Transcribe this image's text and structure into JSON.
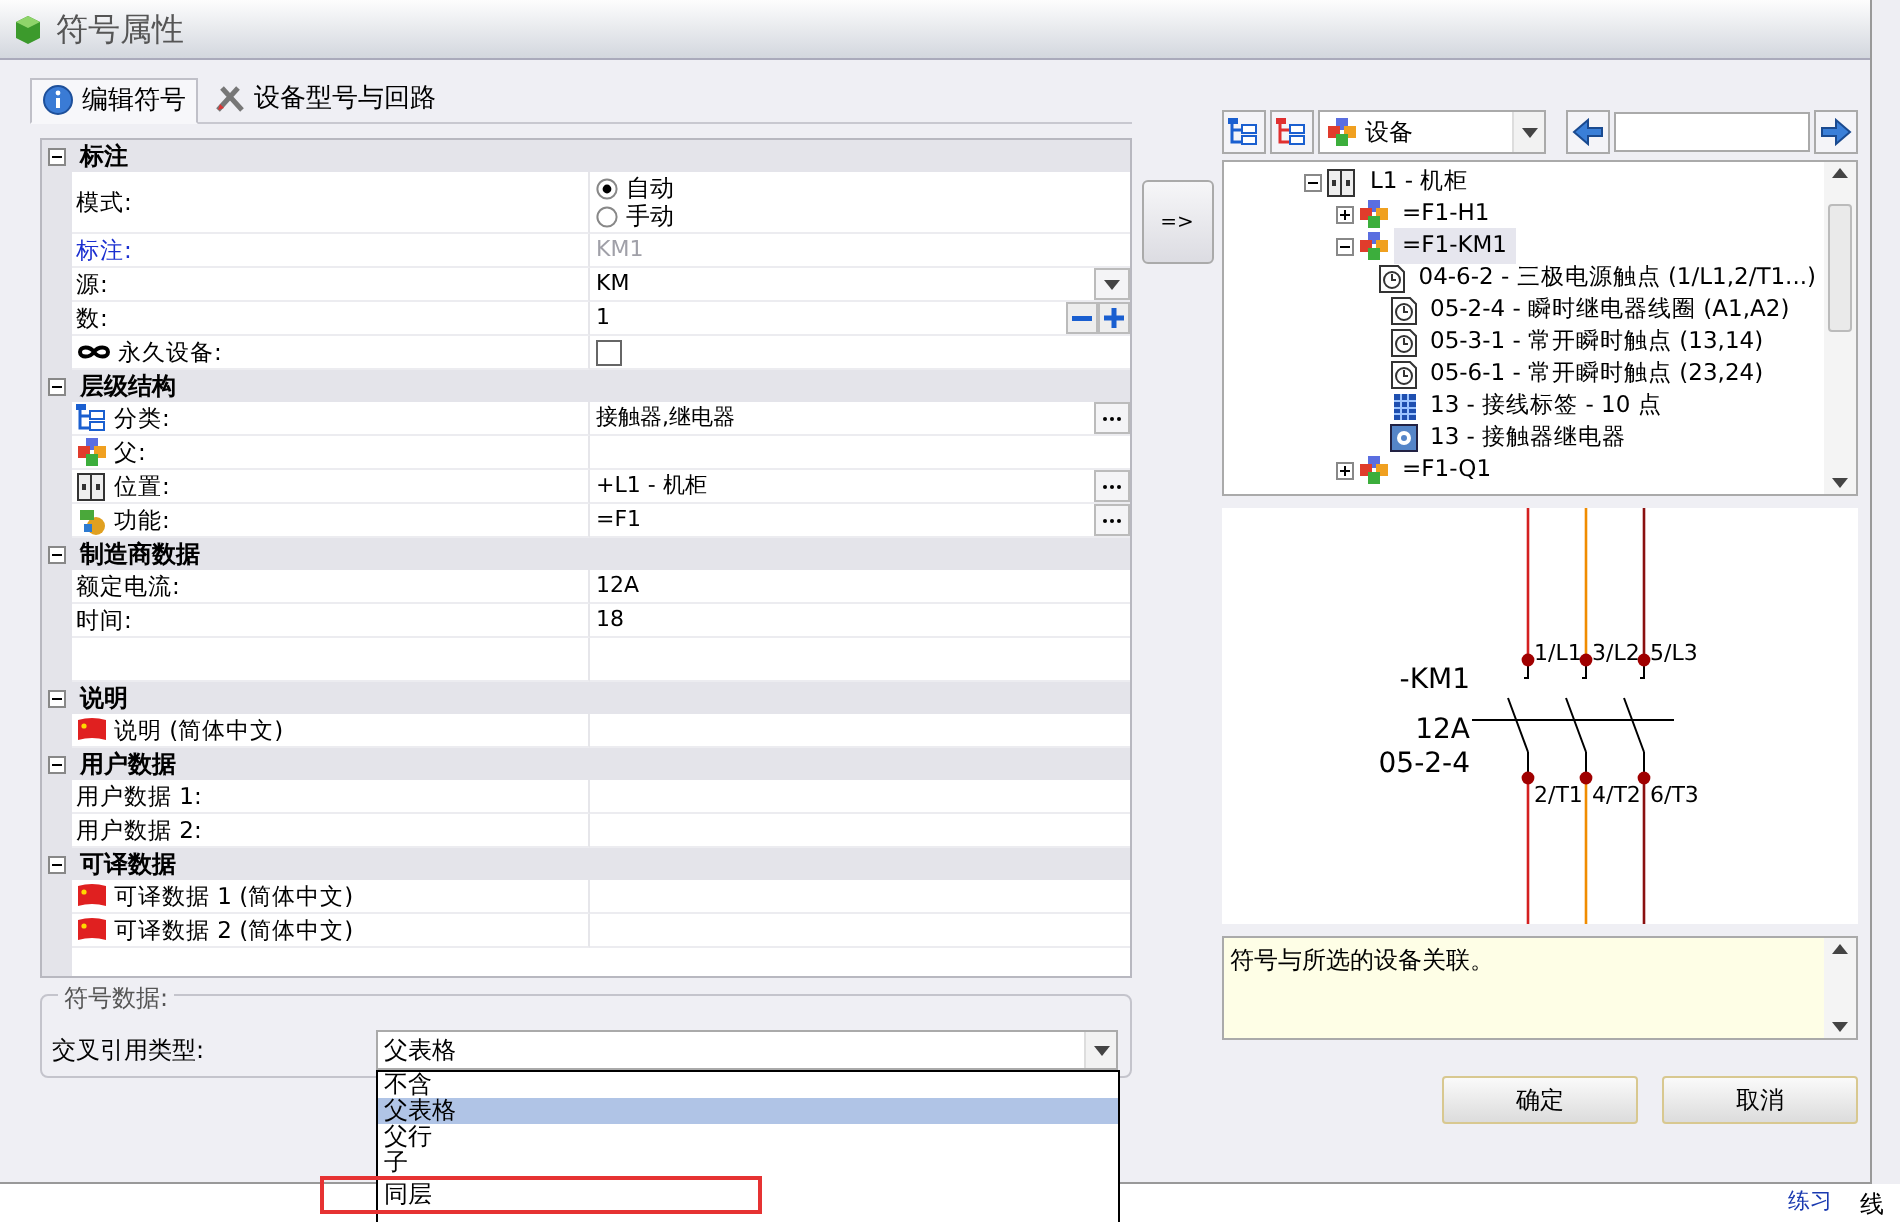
{
  "window": {
    "title": "符号属性"
  },
  "tabs": [
    {
      "label": "编辑符号",
      "selected": true
    },
    {
      "label": "设备型号与回路",
      "selected": false
    }
  ],
  "property_sections": [
    {
      "title": "标注",
      "expanded": true,
      "rows": [
        {
          "kind": "radio",
          "label": "模式:",
          "options": [
            {
              "label": "自动",
              "selected": true
            },
            {
              "label": "手动",
              "selected": false
            }
          ]
        },
        {
          "kind": "text",
          "label": "标注:",
          "value": "KM1",
          "emphasized": true,
          "disabled": true
        },
        {
          "kind": "dropdown",
          "label": "源:",
          "value": "KM"
        },
        {
          "kind": "spinner",
          "label": "数:",
          "value": "1"
        },
        {
          "kind": "checkbox",
          "label": "永久设备:",
          "checked": false
        }
      ]
    },
    {
      "title": "层级结构",
      "expanded": true,
      "rows": [
        {
          "kind": "browse",
          "label": "分类:",
          "value": "接触器,继电器"
        },
        {
          "kind": "text",
          "label": "父:"
        },
        {
          "kind": "browse",
          "label": "位置:",
          "value": "+L1 - 机柜"
        },
        {
          "kind": "browse",
          "label": "功能:",
          "value": "=F1"
        }
      ]
    },
    {
      "title": "制造商数据",
      "expanded": true,
      "rows": [
        {
          "kind": "text",
          "label": "额定电流:",
          "value": "12A"
        },
        {
          "kind": "text",
          "label": "时间:",
          "value": "18"
        },
        {
          "kind": "spacer"
        }
      ]
    },
    {
      "title": "说明",
      "expanded": true,
      "rows": [
        {
          "kind": "text",
          "label": "说明 (简体中文)"
        }
      ]
    },
    {
      "title": "用户数据",
      "expanded": true,
      "rows": [
        {
          "kind": "text",
          "label": "用户数据 1:"
        },
        {
          "kind": "text",
          "label": "用户数据 2:"
        }
      ]
    },
    {
      "title": "可译数据",
      "expanded": true,
      "rows": [
        {
          "kind": "text",
          "label": "可译数据 1 (简体中文)"
        },
        {
          "kind": "text",
          "label": "可译数据 2 (简体中文)"
        }
      ]
    }
  ],
  "symbol_data": {
    "group_title": "符号数据:",
    "cross_reference": {
      "label": "交叉引用类型:",
      "value": "父表格",
      "open": true,
      "options": [
        {
          "label": "不含",
          "selected": false
        },
        {
          "label": "父表格",
          "selected": true
        },
        {
          "label": "父行",
          "selected": false
        },
        {
          "label": "子",
          "selected": false
        },
        {
          "label": "同层",
          "selected": false
        }
      ]
    }
  },
  "transfer_button": "=>",
  "device_browser": {
    "filter": "设备",
    "tree": [
      {
        "kind": "location",
        "label": "L1 - 机柜",
        "expanded": true,
        "selected": false,
        "children": [
          {
            "kind": "device",
            "label": "=F1-H1",
            "expanded": false,
            "selected": false
          },
          {
            "kind": "device",
            "label": "=F1-KM1",
            "expanded": true,
            "selected": true,
            "children": [
              {
                "kind": "symbol",
                "label": "04-6-2 - 三极电源触点 (1/L1,2/T1...)",
                "selected": false
              },
              {
                "kind": "symbol",
                "label": "05-2-4 - 瞬时继电器线圈 (A1,A2)",
                "selected": false
              },
              {
                "kind": "symbol",
                "label": "05-3-1 - 常开瞬时触点 (13,14)",
                "selected": false
              },
              {
                "kind": "symbol",
                "label": "05-6-1 - 常开瞬时触点 (23,24)",
                "selected": false
              },
              {
                "kind": "terminal",
                "label": "13 - 接线标签 - 10 点",
                "selected": false
              },
              {
                "kind": "macro",
                "label": "13 - 接触器继电器",
                "selected": false
              }
            ]
          },
          {
            "kind": "device",
            "label": "=F1-Q1",
            "expanded": false,
            "selected": false
          }
        ]
      }
    ]
  },
  "preview": {
    "designation": "-KM1",
    "rating": "12A",
    "page_ref": "05-2-4",
    "top_terminals": [
      "1/L1",
      "3/L2",
      "5/L3"
    ],
    "bottom_terminals": [
      "2/T1",
      "4/T2",
      "6/T3"
    ]
  },
  "description": "符号与所选的设备关联。",
  "buttons": [
    "确定",
    "取消"
  ],
  "background_app": {
    "link": "练习",
    "text": "线"
  }
}
